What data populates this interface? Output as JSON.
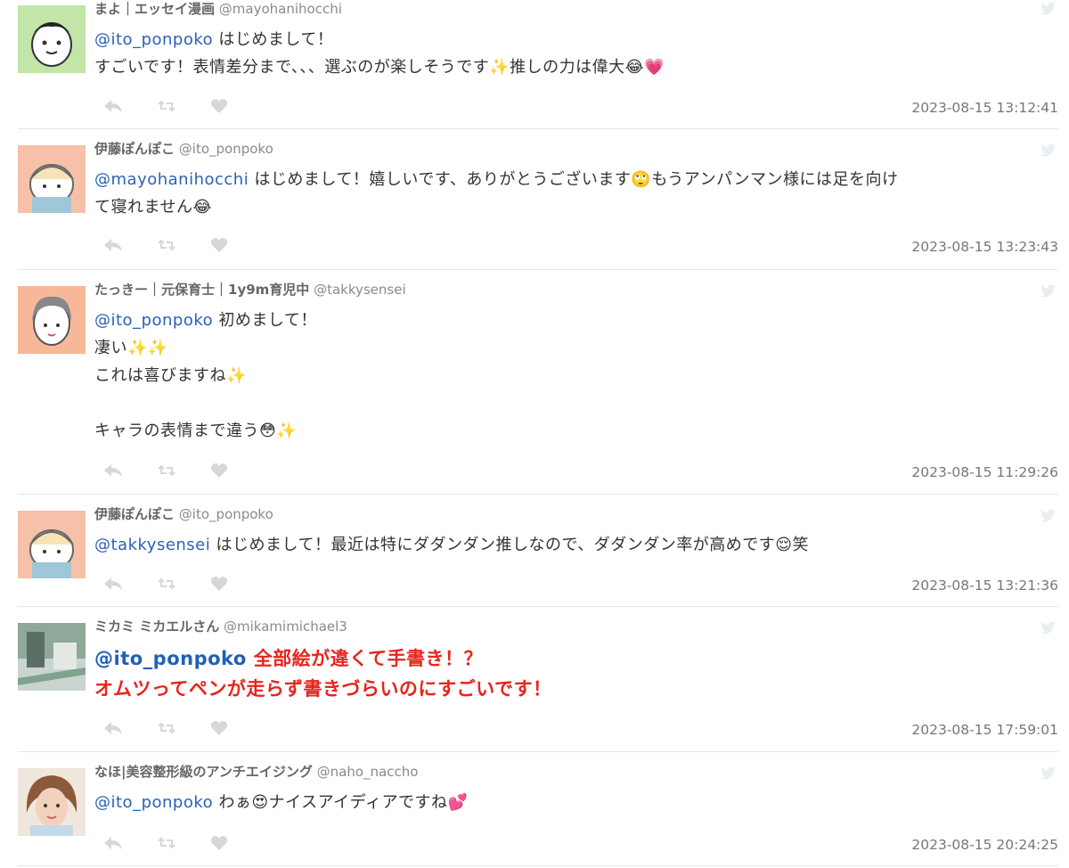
{
  "tweets": [
    {
      "display_name": "まよ｜エッセイ漫画",
      "handle": "@mayohanihocchi",
      "mention": "@ito_ponpoko",
      "lines": [
        "はじめまして！",
        "すごいです！表情差分まで、、、選ぶのが楽しそうです✨推しの力は偉大😂💗"
      ],
      "timestamp": "2023-08-15 13:12:41",
      "avatar_color": "#c1e6a8"
    },
    {
      "display_name": "伊藤ぽんぽこ",
      "handle": "@ito_ponpoko",
      "mention": "@mayohanihocchi",
      "lines": [
        "はじめまして！嬉しいです、ありがとうございます🙄もうアンパンマン様には足を向け",
        "て寝れません😂"
      ],
      "timestamp": "2023-08-15 13:23:43",
      "avatar_color": "#f7c0a8"
    },
    {
      "display_name": "たっきー｜元保育士｜1y9m育児中",
      "handle": "@takkysensei",
      "mention": "@ito_ponpoko",
      "lines": [
        "初めまして！",
        "凄い✨✨",
        "これは喜びますね✨",
        "",
        "キャラの表情まで違う😳✨"
      ],
      "timestamp": "2023-08-15 11:29:26",
      "avatar_color": "#f7b89a"
    },
    {
      "display_name": "伊藤ぽんぽこ",
      "handle": "@ito_ponpoko",
      "mention": "@takkysensei",
      "lines": [
        "はじめまして！最近は特にダダンダン推しなので、ダダンダン率が高めです😌笑"
      ],
      "timestamp": "2023-08-15 13:21:36",
      "avatar_color": "#f7c0a8"
    },
    {
      "display_name": "ミカミ ミカエルさん",
      "handle": "@mikamimichael3",
      "mention": "@ito_ponpoko",
      "lines": [
        "全部絵が違くて手書き！？",
        "オムツってペンが走らず書きづらいのにすごいです！"
      ],
      "timestamp": "2023-08-15 17:59:01",
      "avatar_color": "#8fa89a"
    },
    {
      "display_name": "なほ|美容整形級のアンチエイジング",
      "handle": "@naho_naccho",
      "mention": "@ito_ponpoko",
      "lines": [
        "わぁ😍ナイスアイディアですね💕"
      ],
      "timestamp": "2023-08-15 20:24:25",
      "avatar_color": "#d9a07a"
    }
  ],
  "icons": {
    "reply": "reply-icon",
    "retweet": "retweet-icon",
    "like": "heart-icon",
    "brand": "twitter-bird-icon"
  },
  "colors": {
    "mention": "#2a62b7",
    "highlight_text": "#e8241d",
    "icon_gray": "#d7d7d7",
    "timestamp": "#777777"
  }
}
